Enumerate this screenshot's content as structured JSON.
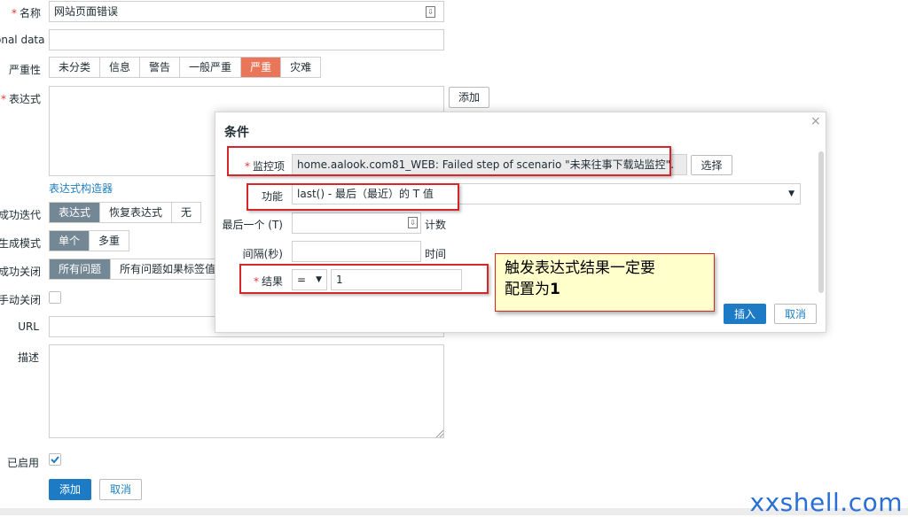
{
  "form": {
    "name": {
      "label": "名称",
      "value": "网站页面错误"
    },
    "operational_data": {
      "label": "onal data",
      "value": ""
    },
    "severity": {
      "label": "严重性",
      "options": [
        "未分类",
        "信息",
        "警告",
        "一般严重",
        "严重",
        "灾难"
      ],
      "selected": "严重"
    },
    "expression": {
      "label": "表达式",
      "value": "",
      "add_label": "添加",
      "builder_link": "表达式构造器"
    },
    "recovery": {
      "label": "成功迭代",
      "options": [
        "表达式",
        "恢复表达式",
        "无"
      ],
      "selected": "表达式"
    },
    "problem_mode": {
      "label": "生成模式",
      "options": [
        "单个",
        "多重"
      ],
      "selected": "单个"
    },
    "ok_close": {
      "label": "成功关闭",
      "options": [
        "所有问题",
        "所有问题如果标签值"
      ],
      "selected": "所有问题"
    },
    "manual_close": {
      "label": "手动关闭"
    },
    "url": {
      "label": "URL",
      "value": ""
    },
    "description": {
      "label": "描述",
      "value": ""
    },
    "enabled": {
      "label": "已启用",
      "checked": true
    },
    "add_button": "添加",
    "cancel_button": "取消"
  },
  "dialog": {
    "title": "条件",
    "close_symbol": "×",
    "item": {
      "label": "监控项",
      "value": "home.aalook.com81_WEB: Failed step of scenario \"未来往事下载站监控\".",
      "select_button": "选择"
    },
    "function": {
      "label": "功能",
      "value": "last() - 最后（最近）的 T 值"
    },
    "last_t": {
      "label": "最后一个 (T)",
      "value": "",
      "unit": "计数"
    },
    "interval": {
      "label": "间隔(秒)",
      "value": "",
      "unit": "时间"
    },
    "result": {
      "label": "结果",
      "operator": "=",
      "value": "1"
    },
    "insert_button": "插入",
    "cancel_button": "取消"
  },
  "annotation": {
    "line1": "触发表达式结果一定要",
    "line2_prefix": "配置为",
    "line2_bold": "1"
  },
  "watermark": "xxshell.com",
  "colors": {
    "accent": "#1c7bc4",
    "selected_severity": "#e97659",
    "selected_segment": "#748795",
    "highlight": "#d7262a",
    "callout_bg": "#ffffcc"
  }
}
